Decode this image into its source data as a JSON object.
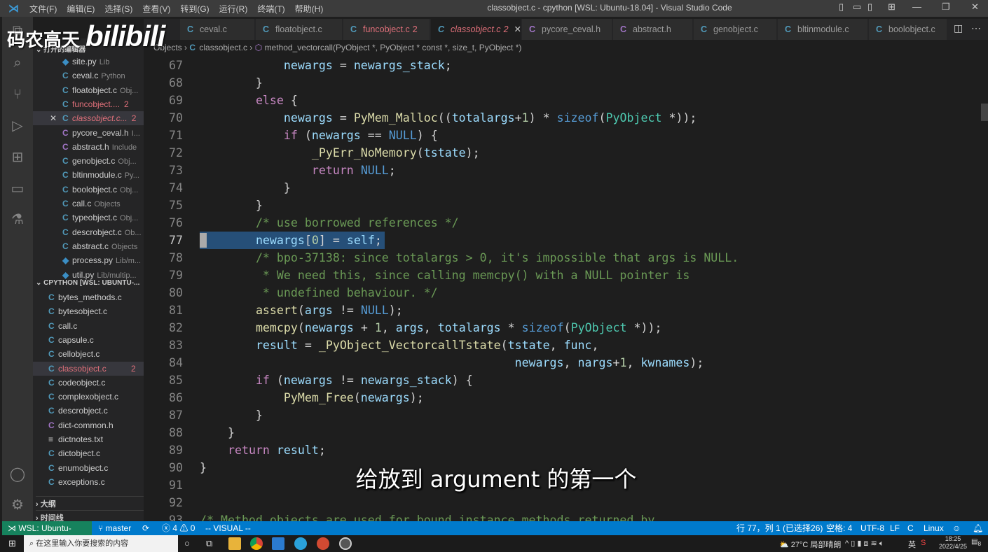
{
  "titlebar": {
    "title": "classobject.c - cpython [WSL: Ubuntu-18.04] - Visual Studio Code",
    "menu": [
      "文件(F)",
      "编辑(E)",
      "选择(S)",
      "查看(V)",
      "转到(G)",
      "运行(R)",
      "终端(T)",
      "帮助(H)"
    ]
  },
  "logo": {
    "text": "码农高天",
    "brand": "bilibili"
  },
  "tabs": [
    {
      "label": "ceval.c",
      "kind": "c"
    },
    {
      "label": "floatobject.c",
      "kind": "c"
    },
    {
      "label": "funcobject.c",
      "badge": "2",
      "kind": "c",
      "error": true
    },
    {
      "label": "classobject.c",
      "badge": "2",
      "kind": "c",
      "active": true,
      "error": true
    },
    {
      "label": "pycore_ceval.h",
      "kind": "h"
    },
    {
      "label": "abstract.h",
      "kind": "h"
    },
    {
      "label": "genobject.c",
      "kind": "c"
    },
    {
      "label": "bltinmodule.c",
      "kind": "c"
    },
    {
      "label": "boolobject.c",
      "kind": "c"
    }
  ],
  "breadcrumb": {
    "folder": "Objects",
    "file": "classobject.c",
    "symbol": "method_vectorcall(PyObject *, PyObject * const *, size_t, PyObject *)"
  },
  "sidebar": {
    "open_editors_title": "打开的编辑器",
    "open_editors": [
      {
        "name": "site.py",
        "desc": "Lib",
        "kind": "py"
      },
      {
        "name": "ceval.c",
        "desc": "Python",
        "kind": "c"
      },
      {
        "name": "floatobject.c",
        "desc": "Obj...",
        "kind": "c"
      },
      {
        "name": "funcobject....",
        "badge": "2",
        "kind": "c",
        "error": true
      },
      {
        "name": "classobject.c...",
        "badge": "2",
        "kind": "c",
        "error": true,
        "selected": true
      },
      {
        "name": "pycore_ceval.h",
        "desc": "I...",
        "kind": "h"
      },
      {
        "name": "abstract.h",
        "desc": "Include",
        "kind": "h"
      },
      {
        "name": "genobject.c",
        "desc": "Obj...",
        "kind": "c"
      },
      {
        "name": "bltinmodule.c",
        "desc": "Py...",
        "kind": "c"
      },
      {
        "name": "boolobject.c",
        "desc": "Obj...",
        "kind": "c"
      },
      {
        "name": "call.c",
        "desc": "Objects",
        "kind": "c"
      },
      {
        "name": "typeobject.c",
        "desc": "Obj...",
        "kind": "c"
      },
      {
        "name": "descrobject.c",
        "desc": "Ob...",
        "kind": "c"
      },
      {
        "name": "abstract.c",
        "desc": "Objects",
        "kind": "c"
      },
      {
        "name": "process.py",
        "desc": "Lib/m...",
        "kind": "py"
      },
      {
        "name": "util.py",
        "desc": "Lib/multip...",
        "kind": "py"
      }
    ],
    "workspace_title": "CPYTHON [WSL: UBUNTU-...",
    "files": [
      {
        "name": "bytes_methods.c",
        "kind": "c"
      },
      {
        "name": "bytesobject.c",
        "kind": "c"
      },
      {
        "name": "call.c",
        "kind": "c"
      },
      {
        "name": "capsule.c",
        "kind": "c"
      },
      {
        "name": "cellobject.c",
        "kind": "c"
      },
      {
        "name": "classobject.c",
        "badge": "2",
        "kind": "c",
        "error": true,
        "selected": true
      },
      {
        "name": "codeobject.c",
        "kind": "c"
      },
      {
        "name": "complexobject.c",
        "kind": "c"
      },
      {
        "name": "descrobject.c",
        "kind": "c"
      },
      {
        "name": "dict-common.h",
        "kind": "h"
      },
      {
        "name": "dictnotes.txt",
        "kind": "txt"
      },
      {
        "name": "dictobject.c",
        "kind": "c"
      },
      {
        "name": "enumobject.c",
        "kind": "c"
      },
      {
        "name": "exceptions.c",
        "kind": "c"
      }
    ],
    "outline": "大纲",
    "timeline": "时间线"
  },
  "editor": {
    "current_line": 77,
    "lines": [
      {
        "n": 67,
        "t": [
          [
            "p",
            "            "
          ],
          [
            "v",
            "newargs"
          ],
          [
            "p",
            " = "
          ],
          [
            "v",
            "newargs_stack"
          ],
          [
            "p",
            ";"
          ]
        ]
      },
      {
        "n": 68,
        "t": [
          [
            "p",
            "        }"
          ]
        ]
      },
      {
        "n": 69,
        "t": [
          [
            "p",
            "        "
          ],
          [
            "k",
            "else"
          ],
          [
            "p",
            " {"
          ]
        ]
      },
      {
        "n": 70,
        "t": [
          [
            "p",
            "            "
          ],
          [
            "v",
            "newargs"
          ],
          [
            "p",
            " = "
          ],
          [
            "f",
            "PyMem_Malloc"
          ],
          [
            "p",
            "(("
          ],
          [
            "v",
            "totalargs"
          ],
          [
            "p",
            "+"
          ],
          [
            "n",
            "1"
          ],
          [
            "p",
            ") * "
          ],
          [
            "b",
            "sizeof"
          ],
          [
            "p",
            "("
          ],
          [
            "t",
            "PyObject"
          ],
          [
            "p",
            " *));"
          ]
        ]
      },
      {
        "n": 71,
        "t": [
          [
            "p",
            "            "
          ],
          [
            "k",
            "if"
          ],
          [
            "p",
            " ("
          ],
          [
            "v",
            "newargs"
          ],
          [
            "p",
            " == "
          ],
          [
            "b",
            "NULL"
          ],
          [
            "p",
            ") {"
          ]
        ]
      },
      {
        "n": 72,
        "t": [
          [
            "p",
            "                "
          ],
          [
            "f",
            "_PyErr_NoMemory"
          ],
          [
            "p",
            "("
          ],
          [
            "v",
            "tstate"
          ],
          [
            "p",
            ");"
          ]
        ]
      },
      {
        "n": 73,
        "t": [
          [
            "p",
            "                "
          ],
          [
            "k",
            "return"
          ],
          [
            "p",
            " "
          ],
          [
            "b",
            "NULL"
          ],
          [
            "p",
            ";"
          ]
        ]
      },
      {
        "n": 74,
        "t": [
          [
            "p",
            "            }"
          ]
        ]
      },
      {
        "n": 75,
        "t": [
          [
            "p",
            "        }"
          ]
        ]
      },
      {
        "n": 76,
        "t": [
          [
            "p",
            "        "
          ],
          [
            "c",
            "/* use borrowed references */"
          ]
        ]
      },
      {
        "n": 77,
        "t": [
          [
            "p",
            "        "
          ],
          [
            "v",
            "newargs"
          ],
          [
            "p",
            "["
          ],
          [
            "n",
            "0"
          ],
          [
            "p",
            "] = "
          ],
          [
            "v",
            "self"
          ],
          [
            "p",
            ";"
          ]
        ]
      },
      {
        "n": 78,
        "t": [
          [
            "p",
            "        "
          ],
          [
            "c",
            "/* bpo-37138: since totalargs > 0, it's impossible that args is NULL."
          ]
        ]
      },
      {
        "n": 79,
        "t": [
          [
            "c",
            "         * We need this, since calling memcpy() with a NULL pointer is"
          ]
        ]
      },
      {
        "n": 80,
        "t": [
          [
            "c",
            "         * undefined behaviour. */"
          ]
        ]
      },
      {
        "n": 81,
        "t": [
          [
            "p",
            "        "
          ],
          [
            "f",
            "assert"
          ],
          [
            "p",
            "("
          ],
          [
            "v",
            "args"
          ],
          [
            "p",
            " != "
          ],
          [
            "b",
            "NULL"
          ],
          [
            "p",
            ");"
          ]
        ]
      },
      {
        "n": 82,
        "t": [
          [
            "p",
            "        "
          ],
          [
            "f",
            "memcpy"
          ],
          [
            "p",
            "("
          ],
          [
            "v",
            "newargs"
          ],
          [
            "p",
            " + "
          ],
          [
            "n",
            "1"
          ],
          [
            "p",
            ", "
          ],
          [
            "v",
            "args"
          ],
          [
            "p",
            ", "
          ],
          [
            "v",
            "totalargs"
          ],
          [
            "p",
            " * "
          ],
          [
            "b",
            "sizeof"
          ],
          [
            "p",
            "("
          ],
          [
            "t",
            "PyObject"
          ],
          [
            "p",
            " *));"
          ]
        ]
      },
      {
        "n": 83,
        "t": [
          [
            "p",
            "        "
          ],
          [
            "v",
            "result"
          ],
          [
            "p",
            " = "
          ],
          [
            "f",
            "_PyObject_VectorcallTstate"
          ],
          [
            "p",
            "("
          ],
          [
            "v",
            "tstate"
          ],
          [
            "p",
            ", "
          ],
          [
            "v",
            "func"
          ],
          [
            "p",
            ","
          ]
        ]
      },
      {
        "n": 84,
        "t": [
          [
            "p",
            "                                             "
          ],
          [
            "v",
            "newargs"
          ],
          [
            "p",
            ", "
          ],
          [
            "v",
            "nargs"
          ],
          [
            "p",
            "+"
          ],
          [
            "n",
            "1"
          ],
          [
            "p",
            ", "
          ],
          [
            "v",
            "kwnames"
          ],
          [
            "p",
            ");"
          ]
        ]
      },
      {
        "n": 85,
        "t": [
          [
            "p",
            "        "
          ],
          [
            "k",
            "if"
          ],
          [
            "p",
            " ("
          ],
          [
            "v",
            "newargs"
          ],
          [
            "p",
            " != "
          ],
          [
            "v",
            "newargs_stack"
          ],
          [
            "p",
            ") {"
          ]
        ]
      },
      {
        "n": 86,
        "t": [
          [
            "p",
            "            "
          ],
          [
            "f",
            "PyMem_Free"
          ],
          [
            "p",
            "("
          ],
          [
            "v",
            "newargs"
          ],
          [
            "p",
            ");"
          ]
        ]
      },
      {
        "n": 87,
        "t": [
          [
            "p",
            "        }"
          ]
        ]
      },
      {
        "n": 88,
        "t": [
          [
            "p",
            "    }"
          ]
        ]
      },
      {
        "n": 89,
        "t": [
          [
            "p",
            "    "
          ],
          [
            "k",
            "return"
          ],
          [
            "p",
            " "
          ],
          [
            "v",
            "result"
          ],
          [
            "p",
            ";"
          ]
        ]
      },
      {
        "n": 90,
        "t": [
          [
            "p",
            "}"
          ]
        ]
      },
      {
        "n": 91,
        "t": []
      },
      {
        "n": 92,
        "t": []
      },
      {
        "n": 93,
        "t": [
          [
            "c",
            "/* Method objects are used for bound instance methods returned by"
          ]
        ]
      }
    ]
  },
  "subtitle": "给放到 argument 的第一个",
  "statusbar": {
    "remote": "WSL: Ubuntu-18.04",
    "branch": "master",
    "errors": "4",
    "warnings": "0",
    "mode": "-- VISUAL --",
    "position": "行 77，列 1 (已选择26)",
    "indent": "空格: 4",
    "encoding": "UTF-8",
    "eol": "LF",
    "language": "C",
    "os": "Linux"
  },
  "taskbar": {
    "search_placeholder": "在这里输入你要搜索的内容",
    "weather": "27°C 局部晴朗",
    "ime": "英",
    "time": "18:25",
    "date": "2022/4/25",
    "notifications": "8"
  },
  "colors": {
    "statusbar": "#007acc",
    "remote": "#16825d",
    "selection": "#264f78",
    "error": "#e0707a"
  }
}
